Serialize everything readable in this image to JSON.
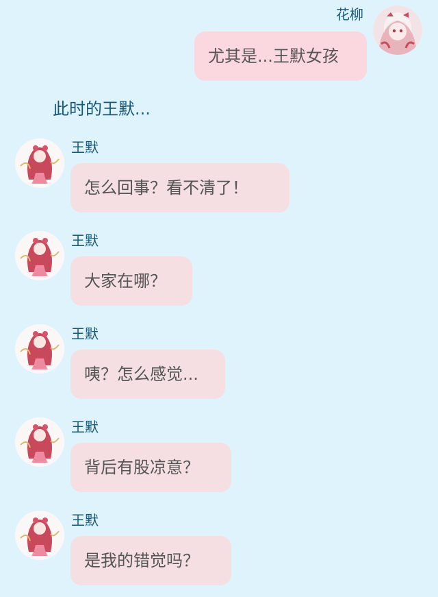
{
  "self_message": {
    "sender": "花柳",
    "avatar_icon": "pink-white-character-avatar-icon",
    "text": "尤其是...王默女孩"
  },
  "narration": "此时的王默...",
  "messages": [
    {
      "sender": "王默",
      "avatar_icon": "pink-dress-girl-avatar-icon",
      "text": "怎么回事？看不清了！"
    },
    {
      "sender": "王默",
      "avatar_icon": "pink-dress-girl-avatar-icon",
      "text": "大家在哪？"
    },
    {
      "sender": "王默",
      "avatar_icon": "pink-dress-girl-avatar-icon",
      "text": "咦？怎么感觉..."
    },
    {
      "sender": "王默",
      "avatar_icon": "pink-dress-girl-avatar-icon",
      "text": "背后有股凉意？"
    },
    {
      "sender": "王默",
      "avatar_icon": "pink-dress-girl-avatar-icon",
      "text": "是我的错觉吗？"
    }
  ],
  "colors": {
    "background": "#def3fc",
    "name_text": "#16587a",
    "bubble_other": "#f5dfe2",
    "bubble_self": "#fbd7df",
    "bubble_text": "#555555"
  }
}
